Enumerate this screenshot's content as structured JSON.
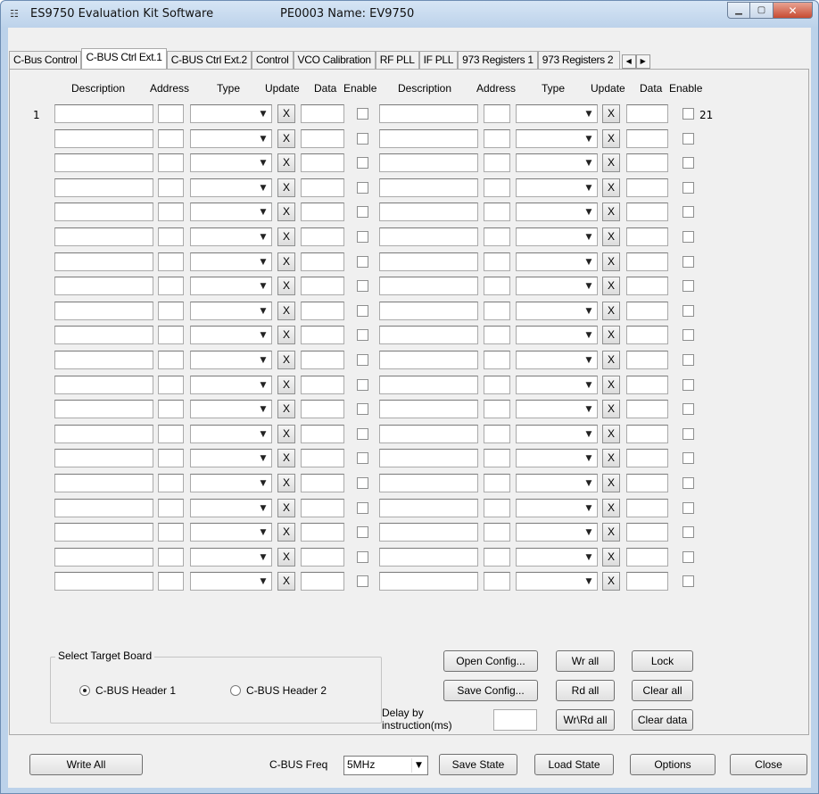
{
  "window": {
    "title": "ES9750 Evaluation Kit Software",
    "name_label": "PE0003 Name: EV9750",
    "icon": "app-icon"
  },
  "tabs": [
    {
      "label": "C-Bus Control",
      "active": false
    },
    {
      "label": "C-BUS Ctrl Ext.1",
      "active": true
    },
    {
      "label": "C-BUS Ctrl Ext.2",
      "active": false
    },
    {
      "label": "Control",
      "active": false
    },
    {
      "label": "VCO Calibration",
      "active": false
    },
    {
      "label": "RF PLL",
      "active": false
    },
    {
      "label": "IF PLL",
      "active": false
    },
    {
      "label": "973 Registers 1",
      "active": false
    },
    {
      "label": "973 Registers 2",
      "active": false
    }
  ],
  "headers": {
    "description": "Description",
    "address": "Address",
    "type": "Type",
    "update": "Update",
    "data": "Data",
    "enable": "Enable"
  },
  "rows": {
    "count": 20,
    "first_left_number": "1",
    "first_right_number": "21",
    "update_label": "X"
  },
  "target_board": {
    "title": "Select Target Board",
    "options": [
      "C-BUS Header 1",
      "C-BUS Header 2"
    ],
    "selected": "C-BUS Header 1"
  },
  "buttons": {
    "open_config": "Open Config...",
    "save_config": "Save Config...",
    "wr_all": "Wr all",
    "rd_all": "Rd all",
    "wr_rd_all": "Wr\\Rd all",
    "lock": "Lock",
    "clear_all": "Clear all",
    "clear_data": "Clear data",
    "write_all": "Write All",
    "save_state": "Save State",
    "load_state": "Load State",
    "options": "Options",
    "close": "Close"
  },
  "delay": {
    "label_line1": "Delay by",
    "label_line2": "instruction(ms)",
    "value": ""
  },
  "freq": {
    "label": "C-BUS Freq",
    "value": "5MHz"
  }
}
